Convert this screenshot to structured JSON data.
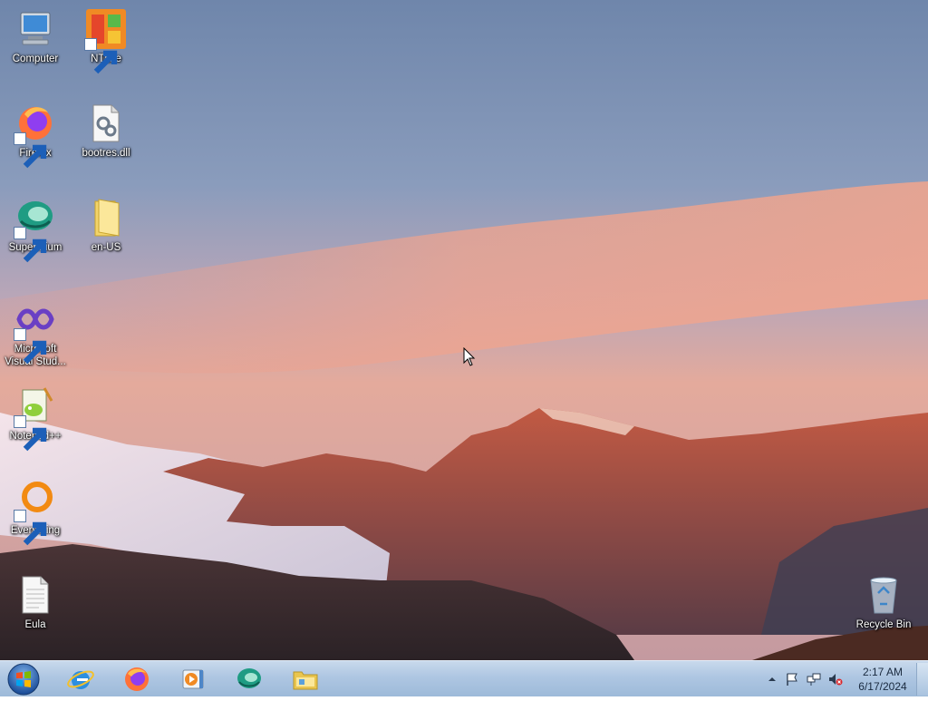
{
  "desktop": {
    "icons": [
      {
        "label": "Computer",
        "icon": "computer-icon",
        "shortcut": false
      },
      {
        "label": "NTLite",
        "icon": "ntlite-icon",
        "shortcut": true
      },
      {
        "label": "Firefox",
        "icon": "firefox-icon",
        "shortcut": true
      },
      {
        "label": "bootres.dll",
        "icon": "dll-file-icon",
        "shortcut": false
      },
      {
        "label": "Supermium",
        "icon": "supermium-icon",
        "shortcut": true
      },
      {
        "label": "en-US",
        "icon": "folder-icon",
        "shortcut": false
      },
      {
        "label": "Microsoft Visual Stud...",
        "icon": "visual-studio-icon",
        "shortcut": true
      },
      {
        "label": "Notepad++",
        "icon": "notepad-plus-plus-icon",
        "shortcut": true
      },
      {
        "label": "Everything",
        "icon": "everything-search-icon",
        "shortcut": true
      },
      {
        "label": "Eula",
        "icon": "text-file-icon",
        "shortcut": false
      },
      {
        "label": "Recycle Bin",
        "icon": "recycle-bin-icon",
        "shortcut": false
      }
    ]
  },
  "taskbar": {
    "start": {
      "icon": "windows-logo-icon"
    },
    "pinned": [
      {
        "name": "internet-explorer",
        "icon": "internet-explorer-icon"
      },
      {
        "name": "firefox",
        "icon": "firefox-icon"
      },
      {
        "name": "media-player",
        "icon": "media-player-icon"
      },
      {
        "name": "supermium",
        "icon": "supermium-icon"
      },
      {
        "name": "file-explorer",
        "icon": "folder-icon"
      }
    ],
    "tray": {
      "icons": [
        "show-hidden-icons-icon",
        "action-center-flag-icon",
        "network-icon",
        "volume-muted-icon"
      ],
      "time": "2:17 AM",
      "date": "6/17/2024"
    }
  },
  "colors": {
    "taskbar_top": "#c8d9ec",
    "taskbar_bottom": "#9dbad9",
    "sky_top": "#6f86ab",
    "sky_glow": "#e8a89a"
  }
}
